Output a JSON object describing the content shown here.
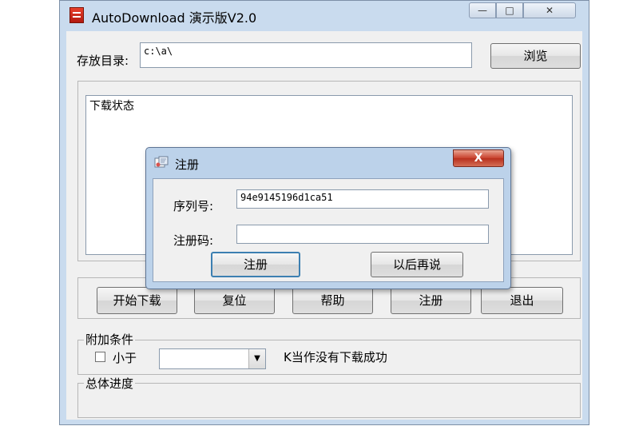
{
  "window": {
    "title": "AutoDownload 演示版V2.0",
    "minimize_glyph": "—",
    "maximize_glyph": "□",
    "close_glyph": "✕"
  },
  "storage": {
    "label": "存放目录:",
    "path_value": "c:\\a\\",
    "browse_label": "浏览"
  },
  "status": {
    "text": "下载状态"
  },
  "actions": {
    "start_download": "开始下载",
    "reset": "复位",
    "help": "帮助",
    "register": "注册",
    "exit": "退出"
  },
  "conditions": {
    "group_title": "附加条件",
    "checkbox_label": "小于",
    "checkbox_checked": false,
    "select_value": "",
    "suffix_text": "K当作没有下载成功"
  },
  "progress": {
    "group_title": "总体进度"
  },
  "register_dialog": {
    "title": "注册",
    "close_glyph": "X",
    "serial_label": "序列号:",
    "serial_value": "94e9145196d1ca51",
    "code_label": "注册码:",
    "code_value": "",
    "register_button": "注册",
    "later_button": "以后再说"
  },
  "icons": {
    "app": "app-icon",
    "dialog": "register-dialog-icon",
    "dropdown": "chevron-down-icon"
  },
  "colors": {
    "titlebar": "#c9dbee",
    "client": "#f0f0f0",
    "dialog_frame": "#bcd2ea",
    "close_button": "#c8402c",
    "default_button_border": "#3c7fb1"
  }
}
